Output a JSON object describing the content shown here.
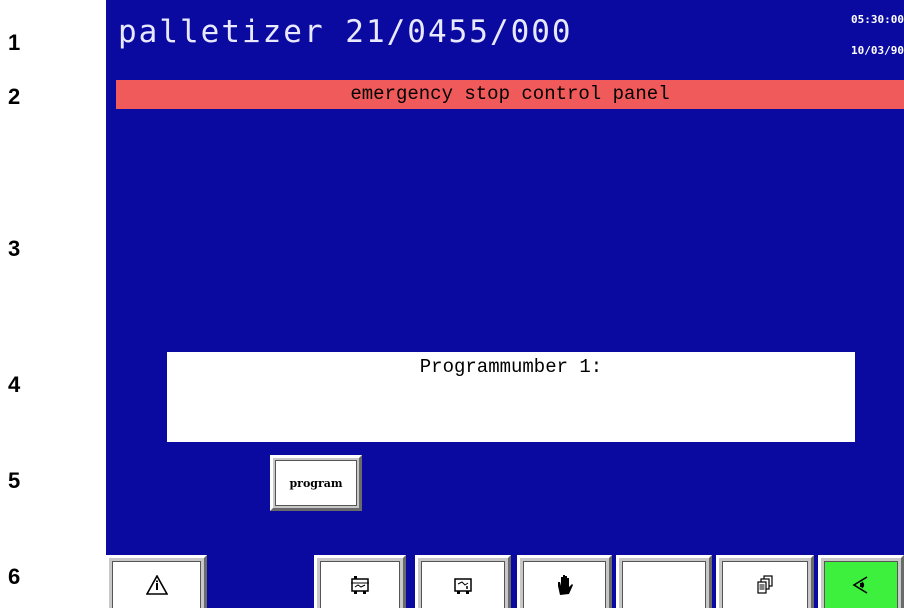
{
  "row_labels": [
    "1",
    "2",
    "3",
    "4",
    "5",
    "6"
  ],
  "header": {
    "title": "palletizer 21/0455/000",
    "time": "05:30:00",
    "date": "10/03/90"
  },
  "banner": {
    "text": "emergency stop control panel"
  },
  "program_panel": {
    "text": "Programmumber 1:"
  },
  "buttons": {
    "program_label": "program"
  },
  "function_keys": [
    {
      "icon": "warning-info-icon"
    },
    {
      "icon": "conveyor-station-icon"
    },
    {
      "icon": "conveyor-station-alt-icon"
    },
    {
      "icon": "manual-hand-icon"
    },
    {
      "icon": "blank"
    },
    {
      "icon": "stacked-pages-icon"
    },
    {
      "icon": "back-speaker-icon"
    }
  ],
  "colors": {
    "screen_background": "#0a0aa0",
    "banner": "#f05a5a",
    "active_key": "#3ef03e"
  }
}
